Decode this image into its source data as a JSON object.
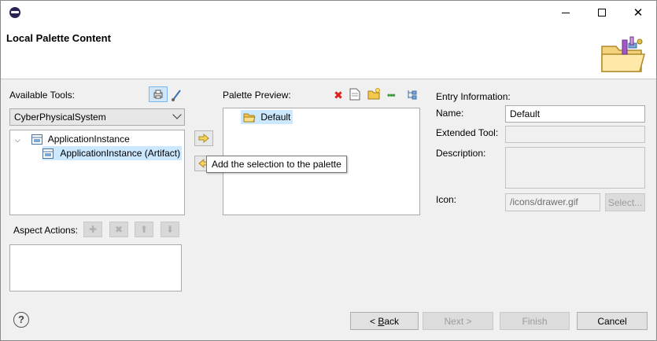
{
  "window": {
    "title": "Local Palette Content"
  },
  "available_tools": {
    "label": "Available Tools:",
    "combo_value": "CyberPhysicalSystem",
    "tree": [
      {
        "label": "ApplicationInstance",
        "level": 0,
        "expanded": true
      },
      {
        "label": "ApplicationInstance (Artifact)",
        "level": 1,
        "selected": true
      }
    ]
  },
  "aspect_actions": {
    "label": "Aspect Actions:"
  },
  "palette_preview": {
    "label": "Palette Preview:",
    "items": [
      {
        "label": "Default",
        "selected": true
      }
    ]
  },
  "tooltip": {
    "text": "Add the selection to the palette"
  },
  "entry": {
    "title": "Entry Information:",
    "name_label": "Name:",
    "name_value": "Default",
    "extended_tool_label": "Extended Tool:",
    "extended_tool_value": "",
    "description_label": "Description:",
    "description_value": "",
    "icon_label": "Icon:",
    "icon_value": "/icons/drawer.gif",
    "select_button": "Select..."
  },
  "footer": {
    "help": "?",
    "back_prefix": "< ",
    "back_mnemonic": "B",
    "back_rest": "ack",
    "next": "Next >",
    "finish": "Finish",
    "cancel": "Cancel"
  }
}
